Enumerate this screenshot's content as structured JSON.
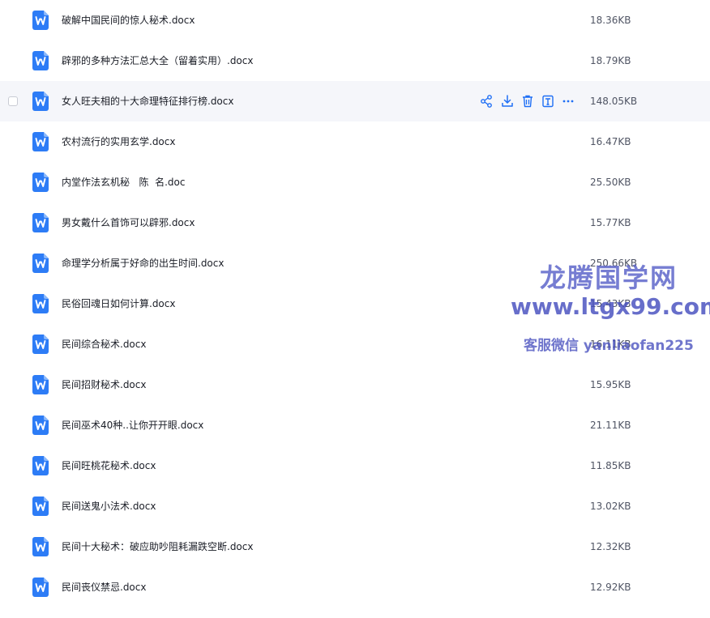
{
  "colors": {
    "accent": "#1f6ff5",
    "icon_blue": "#2d7cf6",
    "hover_row": "#f5f6fa",
    "watermark": "#5860c8"
  },
  "files": [
    {
      "name": "破解中国民间的惊人秘术.docx",
      "size": "18.36KB"
    },
    {
      "name": "辟邪的多种方法汇总大全（留着实用）.docx",
      "size": "18.79KB"
    },
    {
      "name": "女人旺夫相的十大命理特征排行榜.docx",
      "size": "148.05KB",
      "hovered": true
    },
    {
      "name": "农村流行的实用玄学.docx",
      "size": "16.47KB"
    },
    {
      "name": "内堂作法玄机秘   陈  名.doc",
      "size": "25.50KB"
    },
    {
      "name": "男女戴什么首饰可以辟邪.docx",
      "size": "15.77KB"
    },
    {
      "name": "命理学分析属于好命的出生时间.docx",
      "size": "250.66KB"
    },
    {
      "name": "民俗回魂日如何计算.docx",
      "size": "15.43KB"
    },
    {
      "name": "民间综合秘术.docx",
      "size": "16.11KB"
    },
    {
      "name": "民间招财秘术.docx",
      "size": "15.95KB"
    },
    {
      "name": "民间巫术40种..让你开开眼.docx",
      "size": "21.11KB"
    },
    {
      "name": "民间旺桃花秘术.docx",
      "size": "11.85KB"
    },
    {
      "name": "民间送鬼小法术.docx",
      "size": "13.02KB"
    },
    {
      "name": "民间十大秘术：破应助吵阻耗漏跌空断.docx",
      "size": "12.32KB"
    },
    {
      "name": "民间丧仪禁忌.docx",
      "size": "12.92KB"
    }
  ],
  "row_actions": [
    {
      "icon": "share-icon"
    },
    {
      "icon": "download-icon"
    },
    {
      "icon": "delete-icon"
    },
    {
      "icon": "text-icon"
    },
    {
      "icon": "more-icon"
    }
  ],
  "watermark": {
    "title": "龙腾国学网",
    "url": "www.ltgx99.com",
    "contact": "客服微信 yanliaofan225"
  }
}
